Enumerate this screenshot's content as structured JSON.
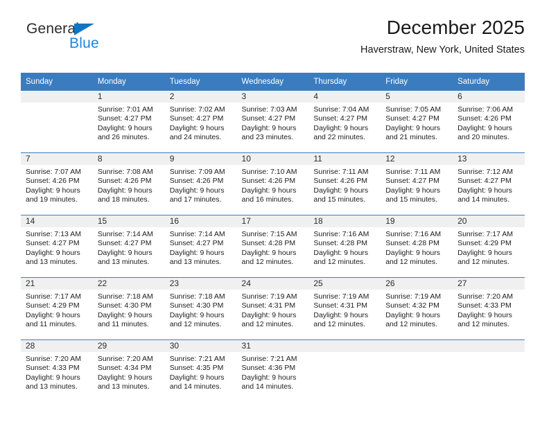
{
  "brand": {
    "name_part1": "General",
    "name_part2": "Blue",
    "triangle_color": "#1275c4",
    "blue_color": "#1c86e0"
  },
  "header": {
    "title": "December 2025",
    "subtitle": "Haverstraw, New York, United States"
  },
  "theme": {
    "header_bar_color": "#3b7cbf",
    "daynum_band_color": "#f0f0f0",
    "week_separator_color": "#3b7cbf",
    "text_color": "#1c1c1c"
  },
  "weekdays": [
    "Sunday",
    "Monday",
    "Tuesday",
    "Wednesday",
    "Thursday",
    "Friday",
    "Saturday"
  ],
  "weeks": [
    [
      {
        "day": "",
        "sunrise": "",
        "sunset": "",
        "daylight_line1": "",
        "daylight_line2": "",
        "empty": true
      },
      {
        "day": "1",
        "sunrise": "Sunrise: 7:01 AM",
        "sunset": "Sunset: 4:27 PM",
        "daylight_line1": "Daylight: 9 hours",
        "daylight_line2": "and 26 minutes."
      },
      {
        "day": "2",
        "sunrise": "Sunrise: 7:02 AM",
        "sunset": "Sunset: 4:27 PM",
        "daylight_line1": "Daylight: 9 hours",
        "daylight_line2": "and 24 minutes."
      },
      {
        "day": "3",
        "sunrise": "Sunrise: 7:03 AM",
        "sunset": "Sunset: 4:27 PM",
        "daylight_line1": "Daylight: 9 hours",
        "daylight_line2": "and 23 minutes."
      },
      {
        "day": "4",
        "sunrise": "Sunrise: 7:04 AM",
        "sunset": "Sunset: 4:27 PM",
        "daylight_line1": "Daylight: 9 hours",
        "daylight_line2": "and 22 minutes."
      },
      {
        "day": "5",
        "sunrise": "Sunrise: 7:05 AM",
        "sunset": "Sunset: 4:27 PM",
        "daylight_line1": "Daylight: 9 hours",
        "daylight_line2": "and 21 minutes."
      },
      {
        "day": "6",
        "sunrise": "Sunrise: 7:06 AM",
        "sunset": "Sunset: 4:26 PM",
        "daylight_line1": "Daylight: 9 hours",
        "daylight_line2": "and 20 minutes."
      }
    ],
    [
      {
        "day": "7",
        "sunrise": "Sunrise: 7:07 AM",
        "sunset": "Sunset: 4:26 PM",
        "daylight_line1": "Daylight: 9 hours",
        "daylight_line2": "and 19 minutes."
      },
      {
        "day": "8",
        "sunrise": "Sunrise: 7:08 AM",
        "sunset": "Sunset: 4:26 PM",
        "daylight_line1": "Daylight: 9 hours",
        "daylight_line2": "and 18 minutes."
      },
      {
        "day": "9",
        "sunrise": "Sunrise: 7:09 AM",
        "sunset": "Sunset: 4:26 PM",
        "daylight_line1": "Daylight: 9 hours",
        "daylight_line2": "and 17 minutes."
      },
      {
        "day": "10",
        "sunrise": "Sunrise: 7:10 AM",
        "sunset": "Sunset: 4:26 PM",
        "daylight_line1": "Daylight: 9 hours",
        "daylight_line2": "and 16 minutes."
      },
      {
        "day": "11",
        "sunrise": "Sunrise: 7:11 AM",
        "sunset": "Sunset: 4:26 PM",
        "daylight_line1": "Daylight: 9 hours",
        "daylight_line2": "and 15 minutes."
      },
      {
        "day": "12",
        "sunrise": "Sunrise: 7:11 AM",
        "sunset": "Sunset: 4:27 PM",
        "daylight_line1": "Daylight: 9 hours",
        "daylight_line2": "and 15 minutes."
      },
      {
        "day": "13",
        "sunrise": "Sunrise: 7:12 AM",
        "sunset": "Sunset: 4:27 PM",
        "daylight_line1": "Daylight: 9 hours",
        "daylight_line2": "and 14 minutes."
      }
    ],
    [
      {
        "day": "14",
        "sunrise": "Sunrise: 7:13 AM",
        "sunset": "Sunset: 4:27 PM",
        "daylight_line1": "Daylight: 9 hours",
        "daylight_line2": "and 13 minutes."
      },
      {
        "day": "15",
        "sunrise": "Sunrise: 7:14 AM",
        "sunset": "Sunset: 4:27 PM",
        "daylight_line1": "Daylight: 9 hours",
        "daylight_line2": "and 13 minutes."
      },
      {
        "day": "16",
        "sunrise": "Sunrise: 7:14 AM",
        "sunset": "Sunset: 4:27 PM",
        "daylight_line1": "Daylight: 9 hours",
        "daylight_line2": "and 13 minutes."
      },
      {
        "day": "17",
        "sunrise": "Sunrise: 7:15 AM",
        "sunset": "Sunset: 4:28 PM",
        "daylight_line1": "Daylight: 9 hours",
        "daylight_line2": "and 12 minutes."
      },
      {
        "day": "18",
        "sunrise": "Sunrise: 7:16 AM",
        "sunset": "Sunset: 4:28 PM",
        "daylight_line1": "Daylight: 9 hours",
        "daylight_line2": "and 12 minutes."
      },
      {
        "day": "19",
        "sunrise": "Sunrise: 7:16 AM",
        "sunset": "Sunset: 4:28 PM",
        "daylight_line1": "Daylight: 9 hours",
        "daylight_line2": "and 12 minutes."
      },
      {
        "day": "20",
        "sunrise": "Sunrise: 7:17 AM",
        "sunset": "Sunset: 4:29 PM",
        "daylight_line1": "Daylight: 9 hours",
        "daylight_line2": "and 12 minutes."
      }
    ],
    [
      {
        "day": "21",
        "sunrise": "Sunrise: 7:17 AM",
        "sunset": "Sunset: 4:29 PM",
        "daylight_line1": "Daylight: 9 hours",
        "daylight_line2": "and 11 minutes."
      },
      {
        "day": "22",
        "sunrise": "Sunrise: 7:18 AM",
        "sunset": "Sunset: 4:30 PM",
        "daylight_line1": "Daylight: 9 hours",
        "daylight_line2": "and 11 minutes."
      },
      {
        "day": "23",
        "sunrise": "Sunrise: 7:18 AM",
        "sunset": "Sunset: 4:30 PM",
        "daylight_line1": "Daylight: 9 hours",
        "daylight_line2": "and 12 minutes."
      },
      {
        "day": "24",
        "sunrise": "Sunrise: 7:19 AM",
        "sunset": "Sunset: 4:31 PM",
        "daylight_line1": "Daylight: 9 hours",
        "daylight_line2": "and 12 minutes."
      },
      {
        "day": "25",
        "sunrise": "Sunrise: 7:19 AM",
        "sunset": "Sunset: 4:31 PM",
        "daylight_line1": "Daylight: 9 hours",
        "daylight_line2": "and 12 minutes."
      },
      {
        "day": "26",
        "sunrise": "Sunrise: 7:19 AM",
        "sunset": "Sunset: 4:32 PM",
        "daylight_line1": "Daylight: 9 hours",
        "daylight_line2": "and 12 minutes."
      },
      {
        "day": "27",
        "sunrise": "Sunrise: 7:20 AM",
        "sunset": "Sunset: 4:33 PM",
        "daylight_line1": "Daylight: 9 hours",
        "daylight_line2": "and 12 minutes."
      }
    ],
    [
      {
        "day": "28",
        "sunrise": "Sunrise: 7:20 AM",
        "sunset": "Sunset: 4:33 PM",
        "daylight_line1": "Daylight: 9 hours",
        "daylight_line2": "and 13 minutes."
      },
      {
        "day": "29",
        "sunrise": "Sunrise: 7:20 AM",
        "sunset": "Sunset: 4:34 PM",
        "daylight_line1": "Daylight: 9 hours",
        "daylight_line2": "and 13 minutes."
      },
      {
        "day": "30",
        "sunrise": "Sunrise: 7:21 AM",
        "sunset": "Sunset: 4:35 PM",
        "daylight_line1": "Daylight: 9 hours",
        "daylight_line2": "and 14 minutes."
      },
      {
        "day": "31",
        "sunrise": "Sunrise: 7:21 AM",
        "sunset": "Sunset: 4:36 PM",
        "daylight_line1": "Daylight: 9 hours",
        "daylight_line2": "and 14 minutes."
      },
      {
        "day": "",
        "sunrise": "",
        "sunset": "",
        "daylight_line1": "",
        "daylight_line2": "",
        "empty": true
      },
      {
        "day": "",
        "sunrise": "",
        "sunset": "",
        "daylight_line1": "",
        "daylight_line2": "",
        "empty": true
      },
      {
        "day": "",
        "sunrise": "",
        "sunset": "",
        "daylight_line1": "",
        "daylight_line2": "",
        "empty": true
      }
    ]
  ]
}
